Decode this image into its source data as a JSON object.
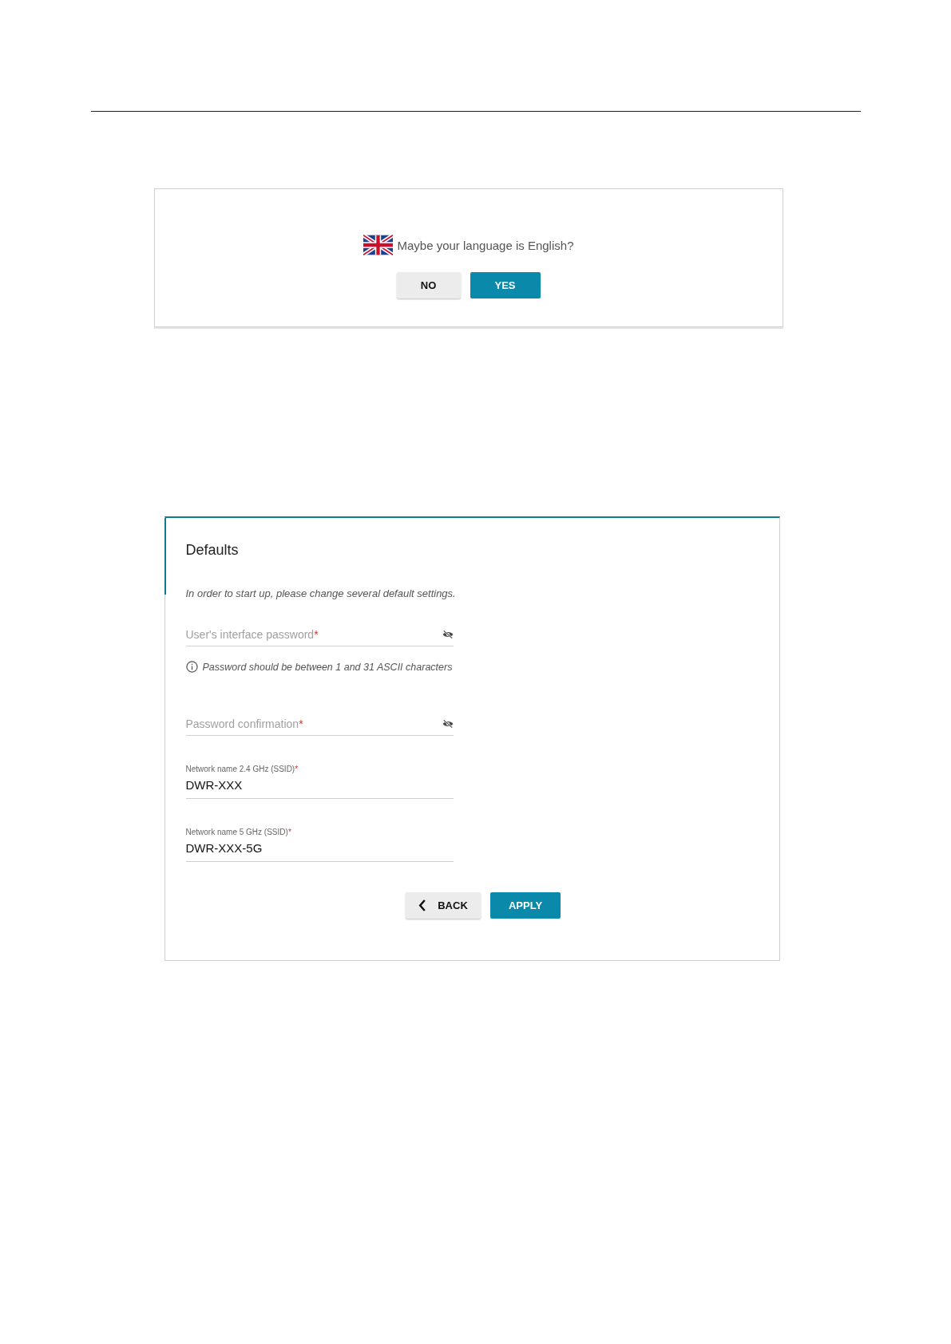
{
  "language_prompt": {
    "question": "Maybe your language is English?",
    "buttons": [
      {
        "label": "NO",
        "kind": "secondary"
      },
      {
        "label": "YES",
        "kind": "primary"
      }
    ]
  },
  "defaults_form": {
    "title": "Defaults",
    "description": "In order to start up, please change several default settings.",
    "fields": [
      {
        "kind": "password",
        "label": "User's interface password",
        "required_mark": "*",
        "hint": "Password should be between 1 and 31 ASCII characters"
      },
      {
        "kind": "password",
        "label": "Password confirmation",
        "required_mark": "*"
      },
      {
        "kind": "text",
        "label": "Network name 2.4 GHz (SSID)",
        "required_mark": "*",
        "value": "DWR-XXX"
      },
      {
        "kind": "text",
        "label": "Network name 5 GHz (SSID)",
        "required_mark": "*",
        "value": "DWR-XXX-5G"
      }
    ],
    "buttons": [
      {
        "label": "BACK",
        "kind": "back"
      },
      {
        "label": "APPLY",
        "kind": "primary"
      }
    ]
  }
}
